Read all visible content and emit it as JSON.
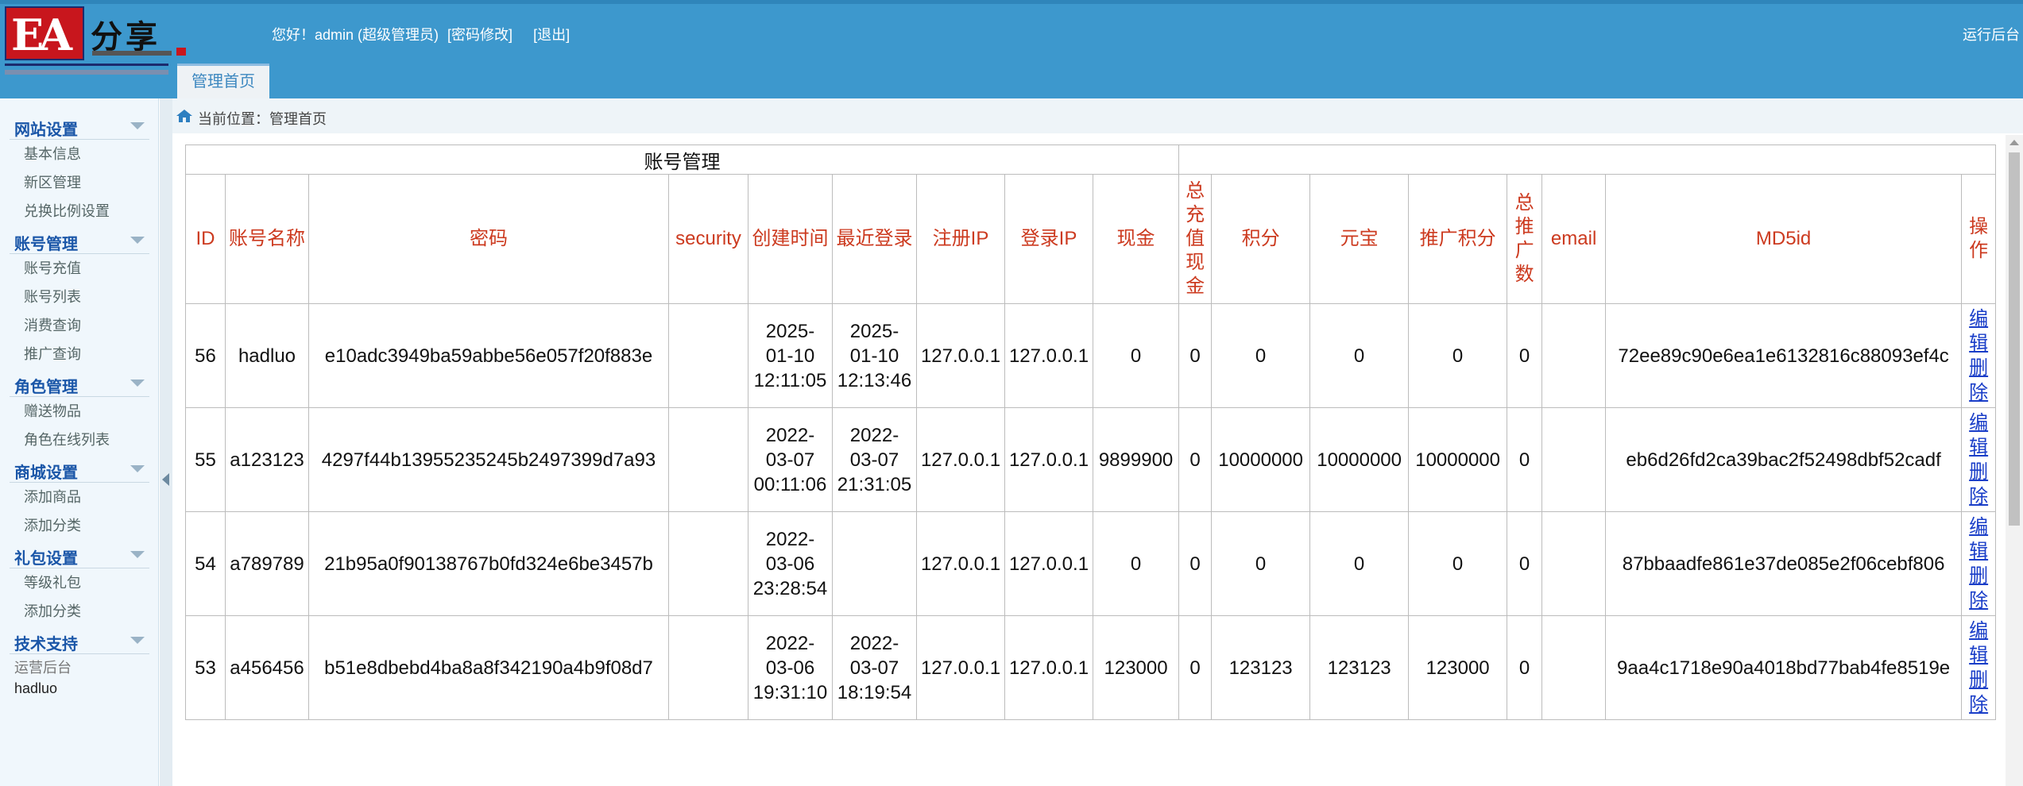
{
  "header": {
    "logo_text": "分享",
    "greeting": "您好！admin (超级管理员)",
    "change_password": "[密码修改]",
    "logout": "[退出]",
    "right_link": "运行后台",
    "tab_home": "管理首页"
  },
  "breadcrumb": {
    "text": "当前位置：管理首页"
  },
  "sidebar": {
    "sections": [
      {
        "title": "网站设置",
        "items": [
          "基本信息",
          "新区管理",
          "兑换比例设置"
        ]
      },
      {
        "title": "账号管理",
        "items": [
          "账号充值",
          "账号列表",
          "消费查询",
          "推广查询"
        ]
      },
      {
        "title": "角色管理",
        "items": [
          "赠送物品",
          "角色在线列表"
        ]
      },
      {
        "title": "商城设置",
        "items": [
          "添加商品",
          "添加分类"
        ]
      },
      {
        "title": "礼包设置",
        "items": [
          "等级礼包",
          "添加分类"
        ]
      },
      {
        "title": "技术支持",
        "items": []
      }
    ],
    "footer_label": "运营后台",
    "footer_user": "hadluo"
  },
  "table": {
    "caption": "账号管理",
    "columns": [
      "ID",
      "账号名称",
      "密码",
      "security",
      "创建时间",
      "最近登录",
      "注册IP",
      "登录IP",
      "现金",
      "总充值现金",
      "积分",
      "元宝",
      "推广积分",
      "总推广数",
      "email",
      "MD5id",
      "操作"
    ],
    "rows": [
      {
        "id": "56",
        "name": "hadluo",
        "password": "e10adc3949ba59abbe56e057f20f883e",
        "security": "",
        "created": [
          "2025-",
          "01-10",
          "12:11:05"
        ],
        "last_login": [
          "2025-",
          "01-10",
          "12:13:46"
        ],
        "reg_ip": "127.0.0.1",
        "login_ip": "127.0.0.1",
        "cash": "0",
        "total_recharge": "0",
        "points": "0",
        "yuanbao": "0",
        "promo_points": "0",
        "promo_count": "0",
        "email": "",
        "md5id": "72ee89c90e6ea1e6132816c88093ef4c"
      },
      {
        "id": "55",
        "name": "a123123",
        "password": "4297f44b13955235245b2497399d7a93",
        "security": "",
        "created": [
          "2022-",
          "03-07",
          "00:11:06"
        ],
        "last_login": [
          "2022-",
          "03-07",
          "21:31:05"
        ],
        "reg_ip": "127.0.0.1",
        "login_ip": "127.0.0.1",
        "cash": "9899900",
        "total_recharge": "0",
        "points": "10000000",
        "yuanbao": "10000000",
        "promo_points": "10000000",
        "promo_count": "0",
        "email": "",
        "md5id": "eb6d26fd2ca39bac2f52498dbf52cadf"
      },
      {
        "id": "54",
        "name": "a789789",
        "password": "21b95a0f90138767b0fd324e6be3457b",
        "security": "",
        "created": [
          "2022-",
          "03-06",
          "23:28:54"
        ],
        "last_login": [
          "",
          "",
          ""
        ],
        "reg_ip": "127.0.0.1",
        "login_ip": "127.0.0.1",
        "cash": "0",
        "total_recharge": "0",
        "points": "0",
        "yuanbao": "0",
        "promo_points": "0",
        "promo_count": "0",
        "email": "",
        "md5id": "87bbaadfe861e37de085e2f06cebf806"
      },
      {
        "id": "53",
        "name": "a456456",
        "password": "b51e8dbebd4ba8a8f342190a4b9f08d7",
        "security": "",
        "created": [
          "2022-",
          "03-06",
          "19:31:10"
        ],
        "last_login": [
          "2022-",
          "03-07",
          "18:19:54"
        ],
        "reg_ip": "127.0.0.1",
        "login_ip": "127.0.0.1",
        "cash": "123000",
        "total_recharge": "0",
        "points": "123123",
        "yuanbao": "123123",
        "promo_points": "123000",
        "promo_count": "0",
        "email": "",
        "md5id": "9aa4c1718e90a4018bd77bab4fe8519e"
      }
    ],
    "edit_label": "编辑",
    "delete_label": "删除",
    "op_separator": "|"
  },
  "colors": {
    "header_bg": "#3d98cd",
    "sidebar_bg": "#f0f7fc",
    "section_title": "#1a56a8",
    "table_header_text": "#cc3a1f",
    "link": "#1a3ec8"
  }
}
